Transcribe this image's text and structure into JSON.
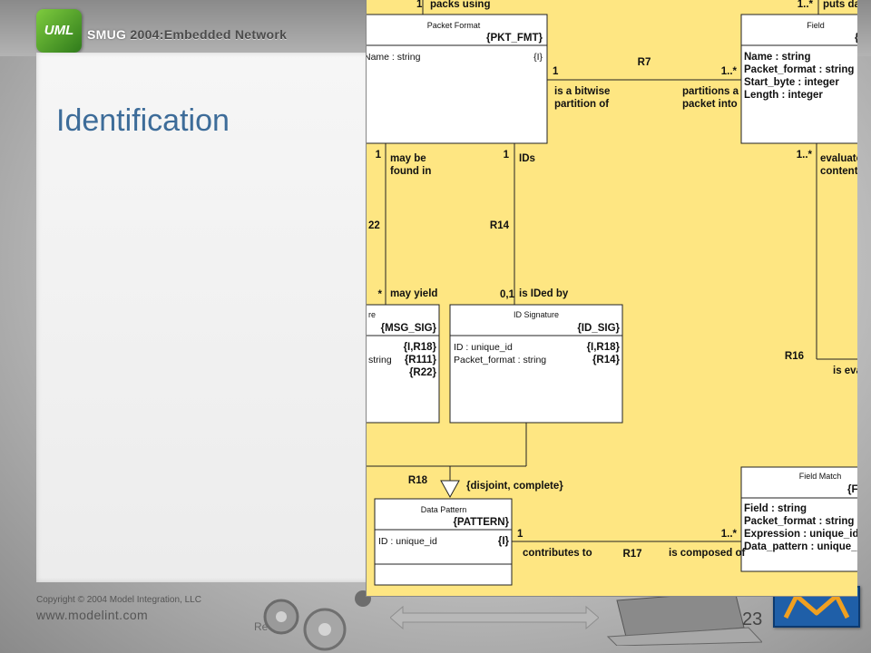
{
  "header": {
    "title_prefix": "SMUG",
    "title_rest": " 2004:Embedded Network",
    "logo_text": "UML"
  },
  "slide": {
    "title": "Identification",
    "rev": "Rev 0.2",
    "page_number": "23"
  },
  "footer": {
    "copyright": "Copyright © 2004 Model Integration, LLC",
    "url": "www.modelint.com"
  },
  "colors": {
    "diagram_bg": "#fee682",
    "title_blue": "#3d6c99",
    "m_logo_blue": "#1f5fa8"
  },
  "diagram": {
    "classes": {
      "packet_format": {
        "name": "Packet Format",
        "id": "{PKT_FMT}",
        "attrs": [
          {
            "name": "Name : string",
            "tag": "{I}"
          }
        ]
      },
      "field": {
        "name": "Field",
        "id": "{I",
        "attrs": [
          {
            "name": "Name : string"
          },
          {
            "name": "Packet_format : string"
          },
          {
            "name": "Start_byte : integer"
          },
          {
            "name": "Length : integer"
          }
        ]
      },
      "msg_sig": {
        "name": "re",
        "id": "{MSG_SIG}",
        "attrs": [
          {
            "name": "",
            "tag": "{I,R18}"
          },
          {
            "name": "string",
            "tag": "{R111}"
          },
          {
            "name": "",
            "tag": "{R22}"
          }
        ]
      },
      "id_signature": {
        "name": "ID Signature",
        "id": "{ID_SIG}",
        "attrs": [
          {
            "name": "ID : unique_id",
            "tag": "{I,R18}"
          },
          {
            "name": "Packet_format : string",
            "tag": "{R14}"
          }
        ]
      },
      "data_pattern": {
        "name": "Data Pattern",
        "id": "{PATTERN}",
        "attrs": [
          {
            "name": "ID : unique_id",
            "tag": "{I}"
          }
        ]
      },
      "field_match": {
        "name": "Field Match",
        "id": "{F",
        "attrs": [
          {
            "name": "Field : string"
          },
          {
            "name": "Packet_format : string"
          },
          {
            "name": "Expression : unique_id"
          },
          {
            "name": "Data_pattern : unique_id"
          }
        ]
      }
    },
    "labels": {
      "top_mult_1": "1",
      "packs_using": "packs using",
      "top_mult_field": "1..*",
      "puts_data": "puts data",
      "r7": "R7",
      "r7_mult_left": "1",
      "r7_mult_right": "1..*",
      "r7_phrase_left_1": "is a bitwise",
      "r7_phrase_left_2": "partition of",
      "r7_phrase_right_1": "partitions a",
      "r7_phrase_right_2": "packet into",
      "r22_mult_top": "1",
      "r22_phrase_top_1": "may be",
      "r22_phrase_top_2": "found in",
      "r22": "22",
      "r22_mult_bottom": "*",
      "r22_phrase_bottom": "may yield",
      "r14_mult_top": "1",
      "r14_phrase_top": "IDs",
      "r14": "R14",
      "r14_mult_bottom": "0,1",
      "r14_phrase_bottom": "is IDed by",
      "r16_mult_top": "1..*",
      "r16_phrase_top_1": "evaluates",
      "r16_phrase_top_2": "contents",
      "r16": "R16",
      "r16_phrase_bottom": "is eval",
      "r18": "R18",
      "r18_constraint": "{disjoint, complete}",
      "r17": "R17",
      "r17_mult_left": "1",
      "r17_mult_right": "1..*",
      "r17_phrase_left": "contributes to",
      "r17_phrase_right": "is composed of"
    }
  }
}
